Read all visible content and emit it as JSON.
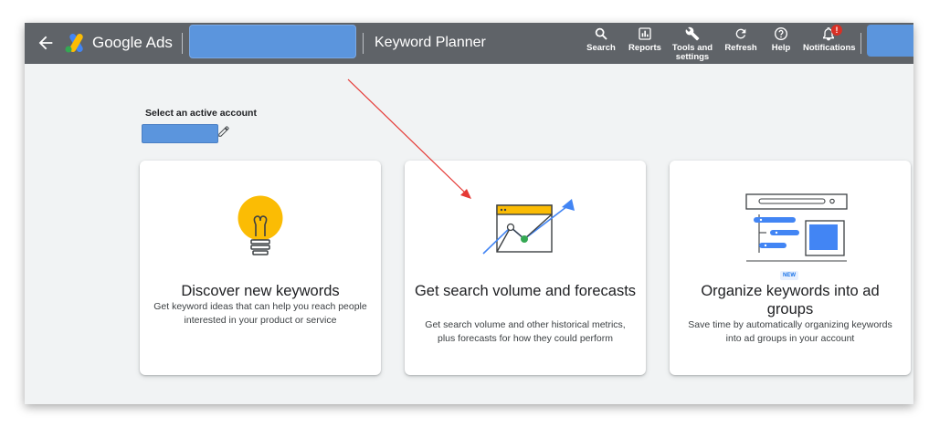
{
  "topbar": {
    "product_name": "Google Ads",
    "page_name": "Keyword Planner",
    "nav": [
      {
        "label": "Search",
        "icon": "search-icon"
      },
      {
        "label": "Reports",
        "icon": "reports-icon"
      },
      {
        "label": "Tools and settings",
        "icon": "wrench-icon"
      },
      {
        "label": "Refresh",
        "icon": "refresh-icon"
      },
      {
        "label": "Help",
        "icon": "help-icon"
      },
      {
        "label": "Notifications",
        "icon": "bell-icon",
        "badge": "!"
      }
    ]
  },
  "account": {
    "label": "Select an active account"
  },
  "cards": [
    {
      "title": "Discover new keywords",
      "description": "Get keyword ideas that can help you reach people interested in your product or service",
      "icon": "lightbulb-illustration"
    },
    {
      "title": "Get search volume and forecasts",
      "description": "Get search volume and other historical metrics, plus forecasts for how they could perform",
      "icon": "chart-trend-illustration"
    },
    {
      "badge": "NEW",
      "title": "Organize keywords into ad groups",
      "description": "Save time by automatically organizing keywords into ad groups in your account",
      "icon": "grouping-illustration"
    }
  ],
  "colors": {
    "topbar": "#5f6368",
    "background": "#f1f3f4",
    "accent_blue": "#4285f4",
    "accent_yellow": "#fbbc04",
    "accent_green": "#34a853",
    "annotation_arrow": "#e53935"
  }
}
